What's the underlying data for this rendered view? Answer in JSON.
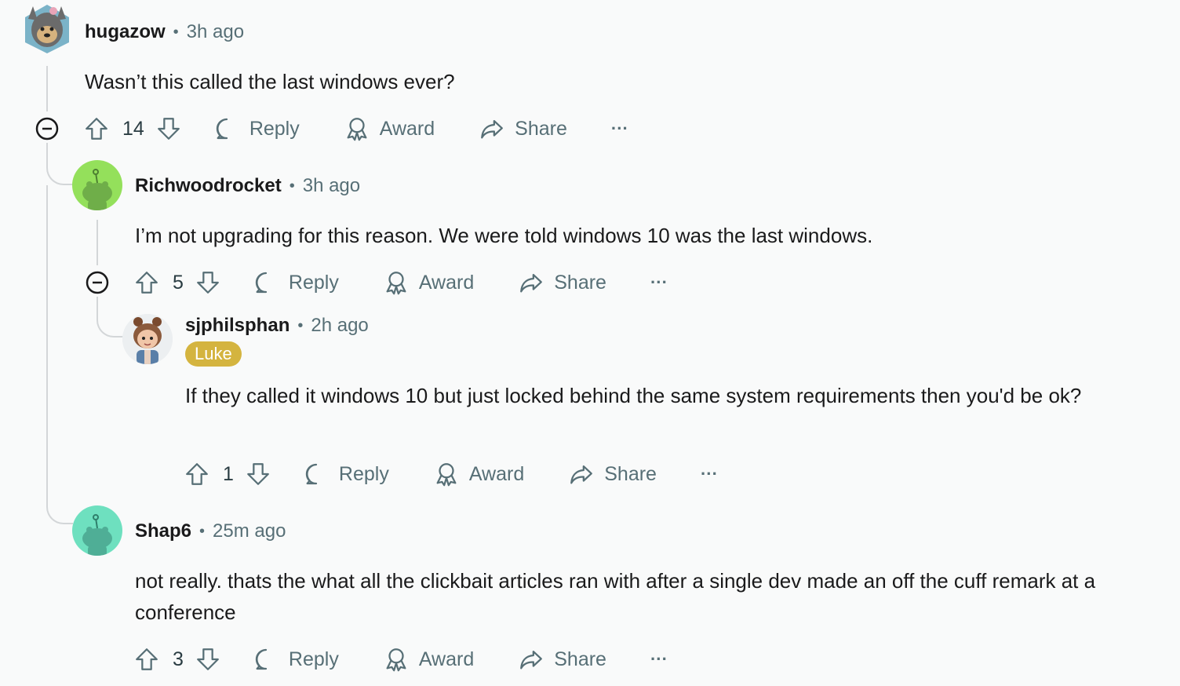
{
  "comments": [
    {
      "username": "hugazow",
      "separator": "•",
      "time": "3h ago",
      "text": "Wasn’t this called the last windows ever?",
      "votes": "14",
      "reply": "Reply",
      "award": "Award",
      "share": "Share",
      "more": "···"
    },
    {
      "username": "Richwoodrocket",
      "separator": "•",
      "time": "3h ago",
      "text": "I’m not upgrading for this reason. We were told windows 10 was the last windows.",
      "votes": "5",
      "reply": "Reply",
      "award": "Award",
      "share": "Share",
      "more": "···"
    },
    {
      "username": "sjphilsphan",
      "separator": "•",
      "time": "2h ago",
      "flair": "Luke",
      "text": "If they called it windows 10 but just locked behind the same system requirements then you'd be ok?",
      "votes": "1",
      "reply": "Reply",
      "award": "Award",
      "share": "Share",
      "more": "···"
    },
    {
      "username": "Shap6",
      "separator": "•",
      "time": "25m ago",
      "text": "not really. thats the what all the clickbait articles ran with after a single dev made an off the cuff remark at a conference",
      "votes": "3",
      "reply": "Reply",
      "award": "Award",
      "share": "Share",
      "more": "···"
    }
  ],
  "colors": {
    "flair": "#d4b43f",
    "avatar_green": "#94e05b",
    "avatar_teal": "#6ee0bf",
    "meta": "#576f76"
  },
  "icons": [
    "upvote-icon",
    "downvote-icon",
    "comment-bubble-icon",
    "award-icon",
    "share-icon",
    "collapse-icon"
  ]
}
